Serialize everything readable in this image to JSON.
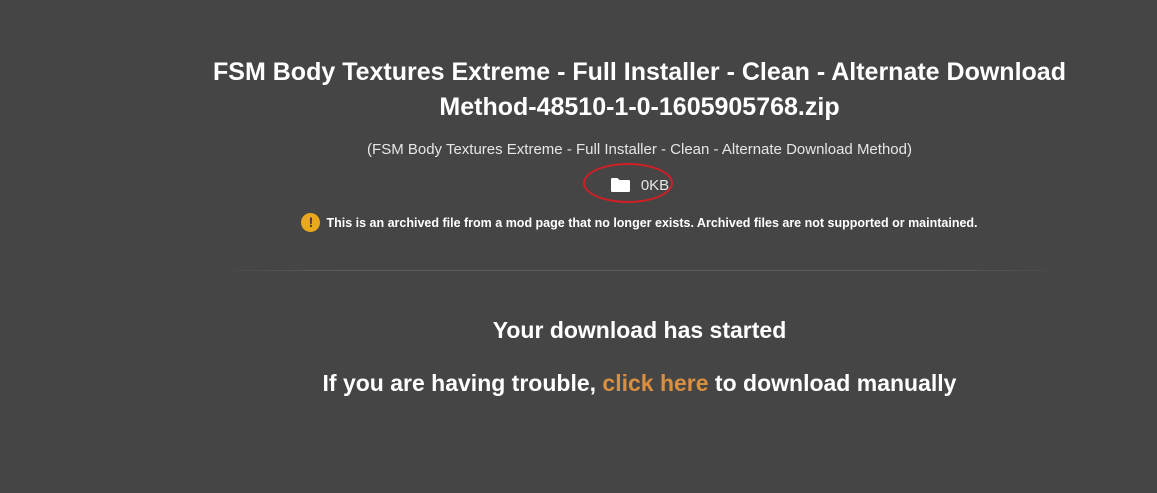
{
  "file": {
    "title": "FSM Body Textures Extreme - Full Installer - Clean - Alternate Download Method-48510-1-0-1605905768.zip",
    "subtitle": "(FSM Body Textures Extreme - Full Installer - Clean - Alternate Download Method)",
    "size": "0KB",
    "size_icon": "folder-icon"
  },
  "notice": {
    "icon": "warning-icon",
    "icon_glyph": "!",
    "text": "This is an archived file from a mod page that no longer exists. Archived files are not supported or maintained."
  },
  "download": {
    "started": "Your download has started",
    "trouble_prefix": "If you are having trouble, ",
    "link_label": "click here",
    "trouble_suffix": " to download manually"
  },
  "colors": {
    "background": "#454545",
    "link": "#d98f40",
    "warning": "#e8a91b",
    "annotation": "#d11f26"
  }
}
